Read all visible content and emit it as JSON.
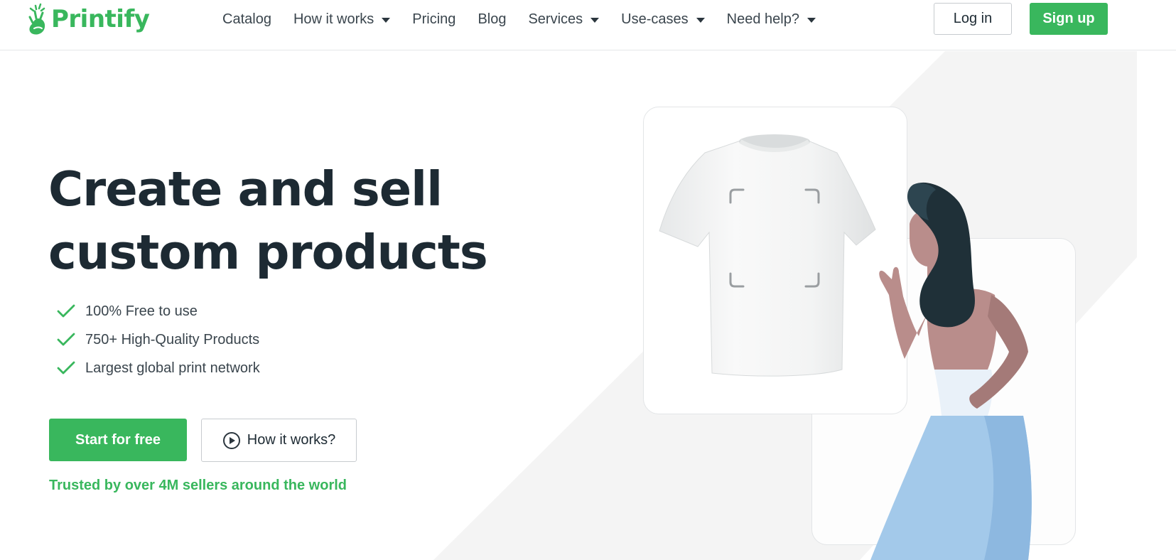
{
  "brand": {
    "name": "Printify",
    "color": "#39b75d"
  },
  "nav": {
    "items": [
      {
        "label": "Catalog",
        "dropdown": false
      },
      {
        "label": "How it works",
        "dropdown": true
      },
      {
        "label": "Pricing",
        "dropdown": false
      },
      {
        "label": "Blog",
        "dropdown": false
      },
      {
        "label": "Services",
        "dropdown": true
      },
      {
        "label": "Use-cases",
        "dropdown": true
      },
      {
        "label": "Need help?",
        "dropdown": true
      }
    ],
    "login_label": "Log in",
    "signup_label": "Sign up"
  },
  "hero": {
    "title_line1": "Create and sell",
    "title_line2": "custom products",
    "features": [
      "100% Free to use",
      "750+ High-Quality Products",
      "Largest global print network"
    ],
    "primary_cta": "Start for free",
    "secondary_cta": "How it works?",
    "trusted": "Trusted by over 4M sellers around the world"
  },
  "colors": {
    "accent": "#39b75d",
    "text": "#1d2a33",
    "background_shape": "#f4f4f4",
    "skirt": "#a3c9ea",
    "skin": "#b98d8b",
    "hair": "#1f3038"
  },
  "icons": [
    "printify-logo-icon",
    "chevron-down-icon",
    "check-icon",
    "play-circle-icon"
  ]
}
